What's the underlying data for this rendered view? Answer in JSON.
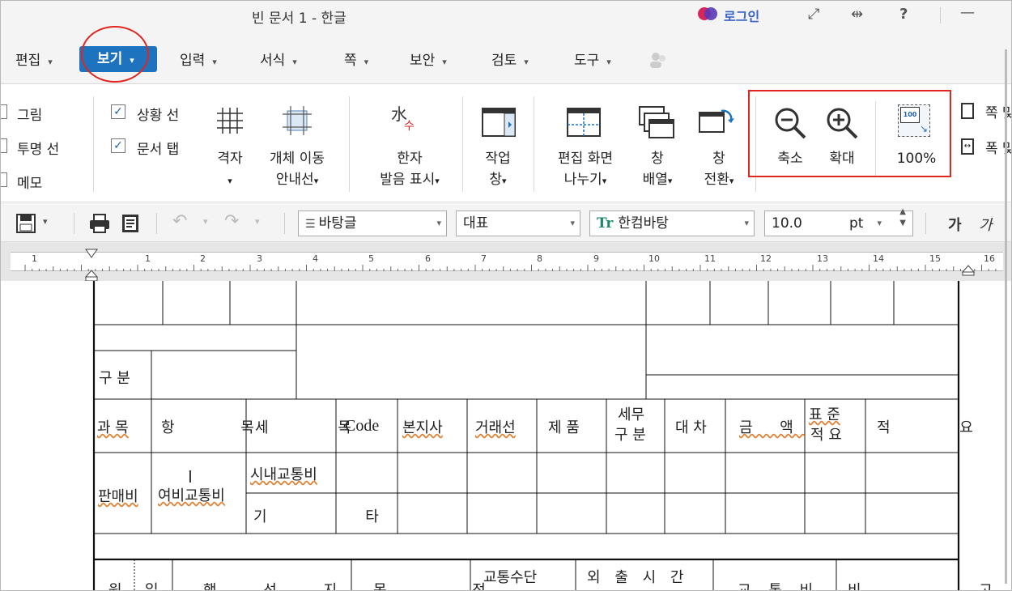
{
  "window": {
    "title": "빈 문서 1 - 한글",
    "login_label": "로그인"
  },
  "menu": {
    "items": [
      {
        "label": "편집"
      },
      {
        "label": "보기"
      },
      {
        "label": "입력"
      },
      {
        "label": "서식"
      },
      {
        "label": "쪽"
      },
      {
        "label": "보안"
      },
      {
        "label": "검토"
      },
      {
        "label": "도구"
      }
    ]
  },
  "ribbon": {
    "checks_col1": [
      {
        "label": "그림"
      },
      {
        "label": "투명 선"
      },
      {
        "label": "메모"
      }
    ],
    "checks_col2": [
      {
        "label": "상황 선",
        "checked": true
      },
      {
        "label": "문서 탭",
        "checked": true
      }
    ],
    "grid": {
      "label": "격자"
    },
    "object_move": {
      "line1": "개체 이동",
      "line2": "안내선"
    },
    "hanja": {
      "line1": "한자",
      "line2": "발음 표시"
    },
    "task": {
      "line1": "작업",
      "line2": "창"
    },
    "split": {
      "line1": "편집 화면",
      "line2": "나누기"
    },
    "arrange": {
      "line1": "창",
      "line2": "배열"
    },
    "switch": {
      "line1": "창",
      "line2": "전환"
    },
    "zoom_out": {
      "label": "축소"
    },
    "zoom_in": {
      "label": "확대"
    },
    "zoom_100": {
      "label": "100%",
      "icon_text": "100"
    },
    "page_width": {
      "line1": "쪽 맞",
      "line2": "폭 맞"
    }
  },
  "toolbar": {
    "style": "바탕글",
    "para": "대표",
    "font": "한컴바탕",
    "size": "10.0",
    "unit": "pt",
    "bold": "가",
    "italic": "가"
  },
  "ruler": {
    "numbers": [
      "1",
      "1",
      "2",
      "3",
      "4",
      "5",
      "6",
      "7",
      "8",
      "9",
      "10",
      "11",
      "12",
      "13",
      "14",
      "15",
      "16"
    ]
  },
  "doc": {
    "gubun": "구 분",
    "headers": [
      "과 목",
      "항 목",
      "세 목",
      "Code",
      "본지사",
      "거래선",
      "제 품",
      "세무",
      "구분",
      "대 차",
      "금 액",
      "표 준",
      "적 요",
      "적 요"
    ],
    "h_gwamok": "과 목",
    "h_hangmok": "항 목",
    "h_semok": "세 목",
    "h_code": "Code",
    "h_bonjisa": "본지사",
    "h_georaeseon": "거래선",
    "h_jepum": "제 품",
    "h_semu1": "세무",
    "h_semu2": "구 분",
    "h_daecha": "대 차",
    "h_geumaek": "금 액",
    "h_pyojun1": "표 준",
    "h_pyojun2": "적 요",
    "h_jeogyo": "적 요",
    "r_panmaebi": "판매비",
    "r_yeobi": "여비교통비",
    "r_sinae": "시내교통비",
    "r_gita": "기 타",
    "b_won": "원",
    "b_il": "일",
    "b_haengseonji": "행 선 지",
    "b_mokjeok": "목 적",
    "b_gyotongsudan": "교통수단",
    "b_oechul": "외 출 시 간",
    "b_gyotongbi": "교 통 비",
    "b_bigo": "비 고"
  },
  "colors": {
    "accent": "#1e73be",
    "highlight": "#e0261e"
  }
}
